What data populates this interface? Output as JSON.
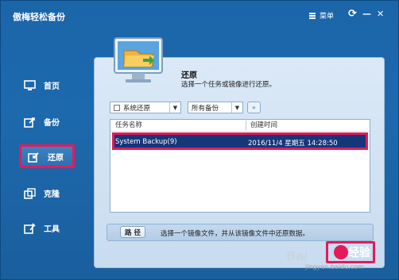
{
  "window": {
    "title": "傲梅轻松备份",
    "menu_label": "菜单",
    "refresh_glyph": "⟳",
    "minimize_glyph": "—",
    "close_glyph": "✕"
  },
  "sidebar": {
    "items": [
      {
        "label": "首页",
        "icon": "monitor-icon"
      },
      {
        "label": "备份",
        "icon": "backup-icon"
      },
      {
        "label": "还原",
        "icon": "restore-icon",
        "active": true
      },
      {
        "label": "克隆",
        "icon": "clone-icon"
      },
      {
        "label": "工具",
        "icon": "tools-icon"
      }
    ]
  },
  "main": {
    "title": "还原",
    "subtitle": "选择一个任务或镜像进行还原。",
    "filter_label": "系统还原",
    "backup_select": "所有备份",
    "more_glyph": "»",
    "table": {
      "columns": [
        "任务名称",
        "创建时间"
      ],
      "rows": [
        {
          "name": "System Backup(9)",
          "time": "2016/11/4 星期五 14:28:50",
          "selected": true
        }
      ]
    },
    "path_button": "路 径",
    "path_desc": "选择一个镜像文件，并从该镜像文件中还原数据。"
  },
  "watermark": {
    "brand": "Bai",
    "jingyan": "经验",
    "url": "jingyan.baidu.com"
  },
  "colors": {
    "window_bg": "#1b65a9",
    "highlight_border": "#e31b5b",
    "selected_row": "#16367a",
    "panel_bg": "#dbe9f7"
  }
}
